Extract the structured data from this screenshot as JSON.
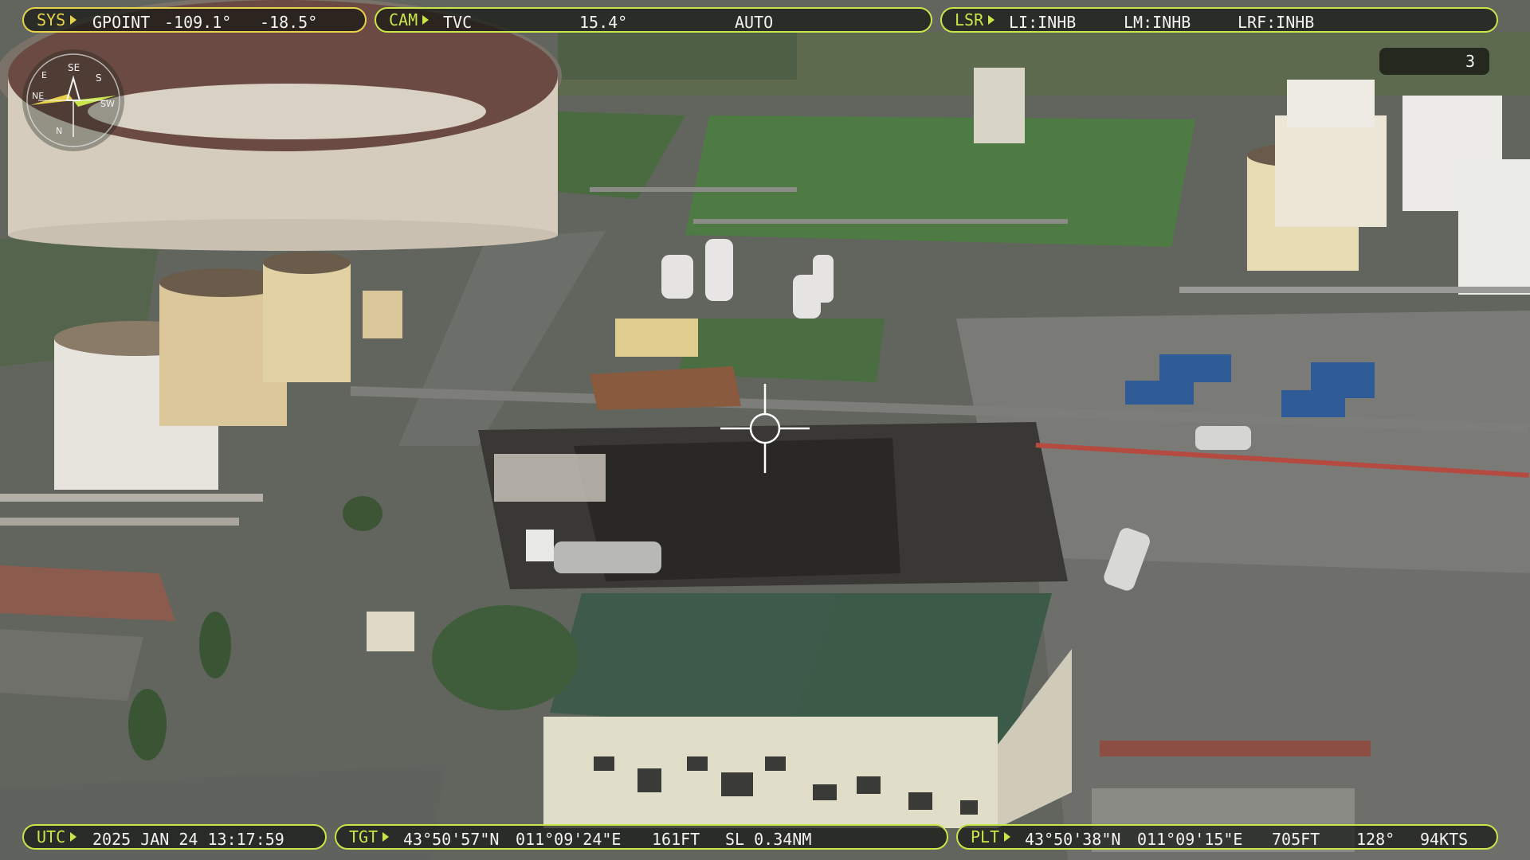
{
  "hud": {
    "sys": {
      "label": "SYS",
      "mode": "GPOINT",
      "az": "-109.1°",
      "el": "-18.5°"
    },
    "cam": {
      "label": "CAM",
      "sensor": "TVC",
      "fov": "15.4°",
      "focus": "AUTO"
    },
    "lsr": {
      "label": "LSR",
      "li": "LI:INHB",
      "lm": "LM:INHB",
      "lrf": "LRF:INHB"
    },
    "counter": "3",
    "compass": {
      "labels": [
        "SE",
        "S",
        "N",
        "NE",
        "E",
        "SW"
      ]
    },
    "utc": {
      "label": "UTC",
      "value": "2025 JAN 24 13:17:59"
    },
    "tgt": {
      "label": "TGT",
      "lat": "43°50'57\"N",
      "lon": "011°09'24\"E",
      "alt": "161FT",
      "range": "SL 0.34NM"
    },
    "plt": {
      "label": "PLT",
      "lat": "43°50'38\"N",
      "lon": "011°09'15\"E",
      "alt": "705FT",
      "heading": "128°",
      "speed": "94KTS"
    }
  },
  "colors": {
    "hud_green": "#c8e64a",
    "hud_yellow": "#e8d24a"
  }
}
